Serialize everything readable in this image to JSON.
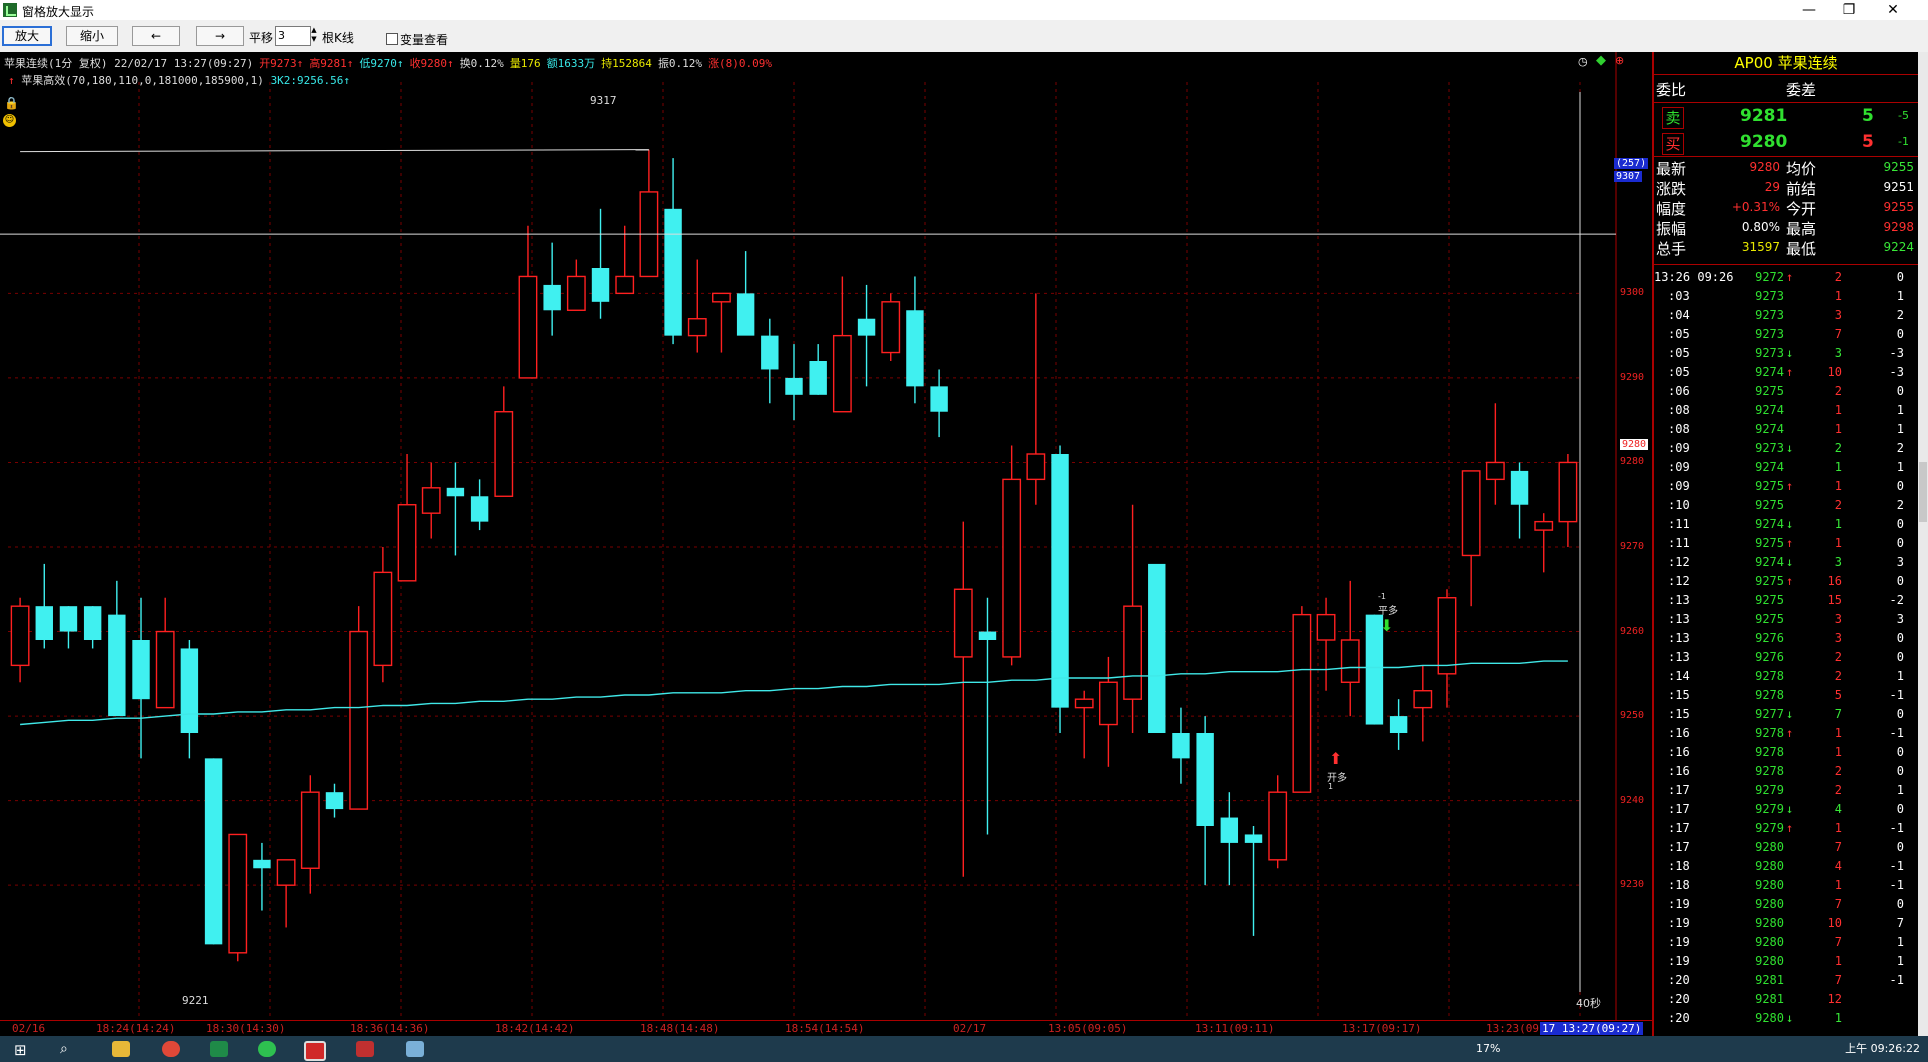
{
  "window": {
    "title": "窗格放大显示",
    "min_icon": "minimize-icon",
    "max_icon": "maximize-icon",
    "close_icon": "close-icon"
  },
  "toolbar": {
    "zoom_in": "放大",
    "zoom_out": "缩小",
    "left": "←",
    "right": "→",
    "shift_label": "平移",
    "shift_value": "3",
    "bars_label": "根K线",
    "variable_label": "变量查看"
  },
  "chart_header": {
    "line1": [
      {
        "text": "苹果连续(1分 复权) 22/02/17 13:27(09:27)",
        "color": "#dddddd"
      },
      {
        "text": "开9273↑",
        "color": "#ff3030"
      },
      {
        "text": "高9281↑",
        "color": "#ff3030"
      },
      {
        "text": "低9270↑",
        "color": "#38e8e8"
      },
      {
        "text": "收9280↑",
        "color": "#ff3030"
      },
      {
        "text": "换0.12%",
        "color": "#dddddd"
      },
      {
        "text": "量176",
        "color": "#e8e800"
      },
      {
        "text": "额1633万",
        "color": "#38e8e8"
      },
      {
        "text": "持152864",
        "color": "#e8e800"
      },
      {
        "text": "振0.12%",
        "color": "#dddddd"
      },
      {
        "text": "涨(8)0.09%",
        "color": "#ff3030"
      }
    ],
    "line2_name": "苹果高效(70,180,110,0,181000,185900,1)",
    "line2_value": "3K2:9256.56↑"
  },
  "y_axis": [
    9300,
    9290,
    9280,
    9270,
    9260,
    9250,
    9240,
    9230
  ],
  "price_tag_current": "9280",
  "price_tag_cursor": "9307",
  "price_tag_count": "(257)",
  "high_label": "9317",
  "low_label": "9221",
  "signal_open": "开多",
  "signal_open_sub": "1",
  "signal_close": "平多",
  "signal_close_sub": "-1",
  "seconds_left": "40秒",
  "x_axis": [
    "02/16",
    "18:24(14:24)",
    "18:30(14:30)",
    "18:36(14:36)",
    "18:42(14:42)",
    "18:48(14:48)",
    "18:54(14:54)",
    "02/17",
    "13:05(09:05)",
    "13:11(09:11)",
    "13:17(09:17)",
    "13:23(09",
    "17 13:27(09:27)"
  ],
  "chart_data": {
    "type": "candlestick",
    "title": "苹果连续(1分 复权)",
    "ylim": [
      9221,
      9317
    ],
    "candles": [
      [
        9256,
        9264,
        9254,
        9263
      ],
      [
        9263,
        9268,
        9258,
        9259
      ],
      [
        9263,
        9263,
        9258,
        9260
      ],
      [
        9263,
        9263,
        9258,
        9259
      ],
      [
        9262,
        9266,
        9253,
        9250
      ],
      [
        9259,
        9264,
        9245,
        9252
      ],
      [
        9251,
        9264,
        9251,
        9260
      ],
      [
        9258,
        9259,
        9245,
        9248
      ],
      [
        9245,
        9245,
        9223,
        9223
      ],
      [
        9222,
        9236,
        9221,
        9236
      ],
      [
        9233,
        9235,
        9227,
        9232
      ],
      [
        9230,
        9232,
        9225,
        9233
      ],
      [
        9232,
        9243,
        9229,
        9241
      ],
      [
        9241,
        9242,
        9238,
        9239
      ],
      [
        9239,
        9263,
        9239,
        9260
      ],
      [
        9256,
        9270,
        9254,
        9267
      ],
      [
        9266,
        9281,
        9266,
        9275
      ],
      [
        9274,
        9280,
        9271,
        9277
      ],
      [
        9277,
        9280,
        9269,
        9276
      ],
      [
        9276,
        9278,
        9272,
        9273
      ],
      [
        9276,
        9289,
        9276,
        9286
      ],
      [
        9290,
        9308,
        9290,
        9302
      ],
      [
        9301,
        9306,
        9295,
        9298
      ],
      [
        9298,
        9304,
        9298,
        9302
      ],
      [
        9303,
        9310,
        9297,
        9299
      ],
      [
        9300,
        9308,
        9300,
        9302
      ],
      [
        9302,
        9317,
        9302,
        9312
      ],
      [
        9310,
        9316,
        9294,
        9295
      ],
      [
        9295,
        9304,
        9293,
        9297
      ],
      [
        9299,
        9300,
        9293,
        9300
      ],
      [
        9300,
        9305,
        9296,
        9295
      ],
      [
        9295,
        9297,
        9287,
        9291
      ],
      [
        9290,
        9294,
        9285,
        9288
      ],
      [
        9292,
        9294,
        9288,
        9288
      ],
      [
        9286,
        9302,
        9286,
        9295
      ],
      [
        9297,
        9301,
        9289,
        9295
      ],
      [
        9293,
        9300,
        9292,
        9299
      ],
      [
        9298,
        9302,
        9287,
        9289
      ],
      [
        9289,
        9291,
        9283,
        9286
      ],
      [
        9257,
        9273,
        9231,
        9265
      ],
      [
        9260,
        9264,
        9236,
        9259
      ],
      [
        9257,
        9282,
        9256,
        9278
      ],
      [
        9278,
        9300,
        9275,
        9281
      ],
      [
        9281,
        9282,
        9248,
        9251
      ],
      [
        9251,
        9253,
        9245,
        9252
      ],
      [
        9249,
        9257,
        9244,
        9254
      ],
      [
        9252,
        9275,
        9248,
        9263
      ],
      [
        9268,
        9267,
        9250,
        9248
      ],
      [
        9248,
        9251,
        9242,
        9245
      ],
      [
        9248,
        9250,
        9230,
        9237
      ],
      [
        9238,
        9241,
        9230,
        9235
      ],
      [
        9236,
        9237,
        9224,
        9235
      ],
      [
        9233,
        9243,
        9232,
        9241
      ],
      [
        9241,
        9263,
        9241,
        9262
      ],
      [
        9259,
        9264,
        9253,
        9262
      ],
      [
        9254,
        9266,
        9250,
        9259
      ],
      [
        9262,
        9262,
        9249,
        9249
      ],
      [
        9250,
        9252,
        9246,
        9248
      ],
      [
        9251,
        9256,
        9247,
        9253
      ],
      [
        9255,
        9265,
        9251,
        9264
      ],
      [
        9269,
        9278,
        9263,
        9279
      ],
      [
        9278,
        9287,
        9275,
        9280
      ],
      [
        9279,
        9280,
        9271,
        9275
      ],
      [
        9272,
        9274,
        9267,
        9273
      ],
      [
        9273,
        9281,
        9270,
        9280
      ]
    ],
    "indicator": {
      "name": "3K2",
      "last": 9256.56
    }
  },
  "side": {
    "title": "AP00 苹果连续",
    "weibi_label": "委比",
    "weicha_label": "委差",
    "sell_label": "卖",
    "buy_label": "买",
    "sell_price": "9281",
    "sell_vol": "5",
    "sell_change": "-5",
    "buy_price": "9280",
    "buy_vol": "5",
    "buy_change": "-1",
    "stats": [
      {
        "l1": "最新",
        "v1": "9280",
        "c1": "#ff3030",
        "l2": "均价",
        "v2": "9255",
        "c2": "#38e838"
      },
      {
        "l1": "涨跌",
        "v1": "29",
        "c1": "#ff3030",
        "l2": "前结",
        "v2": "9251",
        "c2": "#ffffff"
      },
      {
        "l1": "幅度",
        "v1": "+0.31%",
        "c1": "#ff3030",
        "l2": "今开",
        "v2": "9255",
        "c2": "#ff3030"
      },
      {
        "l1": "振幅",
        "v1": "0.80%",
        "c1": "#ffffff",
        "l2": "最高",
        "v2": "9298",
        "c2": "#ff3030"
      },
      {
        "l1": "总手",
        "v1": "31597",
        "c1": "#e8e800",
        "l2": "最低",
        "v2": "9224",
        "c2": "#38e838"
      }
    ],
    "ticks": [
      {
        "t": "13:26 09:26",
        "p": "9272",
        "a": "↑",
        "ac": "#ff3030",
        "v": "2",
        "vc": "#ff3030",
        "c": "0"
      },
      {
        "t": ":03",
        "p": "9273",
        "a": "",
        "ac": "#fff",
        "v": "1",
        "vc": "#ff3030",
        "c": "1"
      },
      {
        "t": ":04",
        "p": "9273",
        "a": "",
        "ac": "#fff",
        "v": "3",
        "vc": "#ff3030",
        "c": "2"
      },
      {
        "t": ":05",
        "p": "9273",
        "a": "",
        "ac": "#fff",
        "v": "7",
        "vc": "#ff3030",
        "c": "0"
      },
      {
        "t": ":05",
        "p": "9273",
        "a": "↓",
        "ac": "#38e838",
        "v": "3",
        "vc": "#38e838",
        "c": "-3"
      },
      {
        "t": ":05",
        "p": "9274",
        "a": "↑",
        "ac": "#ff3030",
        "v": "10",
        "vc": "#ff3030",
        "c": "-3"
      },
      {
        "t": ":06",
        "p": "9275",
        "a": "",
        "ac": "#fff",
        "v": "2",
        "vc": "#ff3030",
        "c": "0"
      },
      {
        "t": ":08",
        "p": "9274",
        "a": "",
        "ac": "#fff",
        "v": "1",
        "vc": "#ff3030",
        "c": "1"
      },
      {
        "t": ":08",
        "p": "9274",
        "a": "",
        "ac": "#fff",
        "v": "1",
        "vc": "#ff3030",
        "c": "1"
      },
      {
        "t": ":09",
        "p": "9273",
        "a": "↓",
        "ac": "#38e838",
        "v": "2",
        "vc": "#38e838",
        "c": "2"
      },
      {
        "t": ":09",
        "p": "9274",
        "a": "",
        "ac": "#fff",
        "v": "1",
        "vc": "#38e838",
        "c": "1"
      },
      {
        "t": ":09",
        "p": "9275",
        "a": "↑",
        "ac": "#ff3030",
        "v": "1",
        "vc": "#ff3030",
        "c": "0"
      },
      {
        "t": ":10",
        "p": "9275",
        "a": "",
        "ac": "#fff",
        "v": "2",
        "vc": "#ff3030",
        "c": "2"
      },
      {
        "t": ":11",
        "p": "9274",
        "a": "↓",
        "ac": "#38e838",
        "v": "1",
        "vc": "#38e838",
        "c": "0"
      },
      {
        "t": ":11",
        "p": "9275",
        "a": "↑",
        "ac": "#ff3030",
        "v": "1",
        "vc": "#ff3030",
        "c": "0"
      },
      {
        "t": ":12",
        "p": "9274",
        "a": "↓",
        "ac": "#38e838",
        "v": "3",
        "vc": "#38e838",
        "c": "3"
      },
      {
        "t": ":12",
        "p": "9275",
        "a": "↑",
        "ac": "#ff3030",
        "v": "16",
        "vc": "#ff3030",
        "c": "0"
      },
      {
        "t": ":13",
        "p": "9275",
        "a": "",
        "ac": "#fff",
        "v": "15",
        "vc": "#ff3030",
        "c": "-2"
      },
      {
        "t": ":13",
        "p": "9275",
        "a": "",
        "ac": "#fff",
        "v": "3",
        "vc": "#ff3030",
        "c": "3"
      },
      {
        "t": ":13",
        "p": "9276",
        "a": "",
        "ac": "#fff",
        "v": "3",
        "vc": "#ff3030",
        "c": "0"
      },
      {
        "t": ":13",
        "p": "9276",
        "a": "",
        "ac": "#fff",
        "v": "2",
        "vc": "#ff3030",
        "c": "0"
      },
      {
        "t": ":14",
        "p": "9278",
        "a": "",
        "ac": "#fff",
        "v": "2",
        "vc": "#ff3030",
        "c": "1"
      },
      {
        "t": ":15",
        "p": "9278",
        "a": "",
        "ac": "#fff",
        "v": "5",
        "vc": "#ff3030",
        "c": "-1"
      },
      {
        "t": ":15",
        "p": "9277",
        "a": "↓",
        "ac": "#38e838",
        "v": "7",
        "vc": "#38e838",
        "c": "0"
      },
      {
        "t": ":16",
        "p": "9278",
        "a": "↑",
        "ac": "#ff3030",
        "v": "1",
        "vc": "#ff3030",
        "c": "-1"
      },
      {
        "t": ":16",
        "p": "9278",
        "a": "",
        "ac": "#fff",
        "v": "1",
        "vc": "#ff3030",
        "c": "0"
      },
      {
        "t": ":16",
        "p": "9278",
        "a": "",
        "ac": "#fff",
        "v": "2",
        "vc": "#ff3030",
        "c": "0"
      },
      {
        "t": ":17",
        "p": "9279",
        "a": "",
        "ac": "#fff",
        "v": "2",
        "vc": "#ff3030",
        "c": "1"
      },
      {
        "t": ":17",
        "p": "9279",
        "a": "↓",
        "ac": "#38e838",
        "v": "4",
        "vc": "#38e838",
        "c": "0"
      },
      {
        "t": ":17",
        "p": "9279",
        "a": "↑",
        "ac": "#ff3030",
        "v": "1",
        "vc": "#ff3030",
        "c": "-1"
      },
      {
        "t": ":17",
        "p": "9280",
        "a": "",
        "ac": "#fff",
        "v": "7",
        "vc": "#ff3030",
        "c": "0"
      },
      {
        "t": ":18",
        "p": "9280",
        "a": "",
        "ac": "#fff",
        "v": "4",
        "vc": "#ff3030",
        "c": "-1"
      },
      {
        "t": ":18",
        "p": "9280",
        "a": "",
        "ac": "#fff",
        "v": "1",
        "vc": "#ff3030",
        "c": "-1"
      },
      {
        "t": ":19",
        "p": "9280",
        "a": "",
        "ac": "#fff",
        "v": "7",
        "vc": "#ff3030",
        "c": "0"
      },
      {
        "t": ":19",
        "p": "9280",
        "a": "",
        "ac": "#fff",
        "v": "10",
        "vc": "#ff3030",
        "c": "7"
      },
      {
        "t": ":19",
        "p": "9280",
        "a": "",
        "ac": "#fff",
        "v": "7",
        "vc": "#ff3030",
        "c": "1"
      },
      {
        "t": ":19",
        "p": "9280",
        "a": "",
        "ac": "#fff",
        "v": "1",
        "vc": "#ff3030",
        "c": "1"
      },
      {
        "t": ":20",
        "p": "9281",
        "a": "",
        "ac": "#fff",
        "v": "7",
        "vc": "#ff3030",
        "c": "-1"
      },
      {
        "t": ":20",
        "p": "9281",
        "a": "",
        "ac": "#fff",
        "v": "12",
        "vc": "#ff3030",
        "c": ""
      },
      {
        "t": ":20",
        "p": "9280",
        "a": "↓",
        "ac": "#38e838",
        "v": "1",
        "vc": "#38e838",
        "c": ""
      }
    ]
  },
  "taskbar": {
    "percent": "17%",
    "time": "上午 09:26:22"
  },
  "colors": {
    "up": "#ff2020",
    "down": "#40f0f0",
    "grid": "#7a0000",
    "indicator": "#40e8e8"
  }
}
